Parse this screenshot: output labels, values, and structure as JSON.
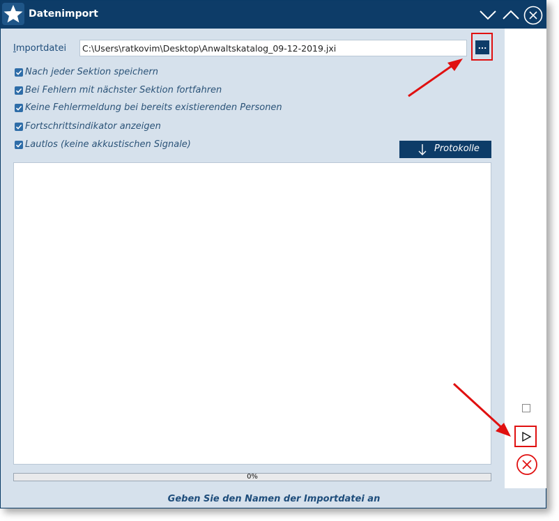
{
  "window": {
    "title": "Datenimport",
    "title_icon": "star-icon",
    "controls": [
      "chevron-down-icon",
      "chevron-up-icon",
      "close-circle-icon"
    ]
  },
  "import": {
    "label_first": "I",
    "label_rest": "mportdatei",
    "file_path": "C:\\Users\\ratkovim\\Desktop\\Anwaltskatalog_09-12-2019.jxi",
    "browse_label": "..."
  },
  "options": [
    {
      "label": "Nach jeder Sektion speichern",
      "checked": true
    },
    {
      "label": "Bei Fehlern mit nächster Sektion fortfahren",
      "checked": true
    },
    {
      "label": "Keine Fehlermeldung bei bereits existierenden Personen",
      "checked": true
    },
    {
      "label": "Fortschrittsindikator anzeigen",
      "checked": true
    },
    {
      "label": "Lautlos (keine akkustischen Signale)",
      "checked": true
    }
  ],
  "protokolle": {
    "label": "Protokolle",
    "icon": "arrow-down-icon"
  },
  "progress": {
    "percent": 0,
    "label": "0%"
  },
  "status": "Geben Sie den Namen der Importdatei an",
  "side": {
    "run_icon": "play-icon",
    "cancel_icon": "cancel-circle-icon"
  },
  "colors": {
    "titlebar": "#0d3c68",
    "panel": "#d6e1ec",
    "accent": "#1e4d7b",
    "highlight": "#e01010"
  }
}
